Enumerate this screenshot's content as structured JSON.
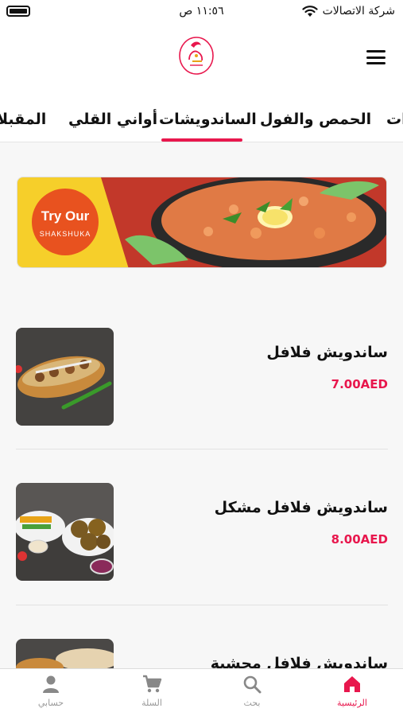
{
  "status_bar": {
    "time": "١١:٥٦ ص",
    "carrier": "شركة الاتصالات"
  },
  "header": {
    "logo_icon": "restaurant-logo-icon",
    "menu_icon": "hamburger-menu-icon"
  },
  "tabs": [
    {
      "label": "ات",
      "active": false
    },
    {
      "label": "الحمص والفول",
      "active": false
    },
    {
      "label": "الساندويشات",
      "active": true
    },
    {
      "label": "أواني القلي",
      "active": false
    },
    {
      "label": "المقبلا",
      "active": false
    }
  ],
  "banner": {
    "headline": "Try Our",
    "subline": "SHAKSHUKA"
  },
  "items": [
    {
      "name": "ساندويش  فلافل",
      "price": "7.00AED"
    },
    {
      "name": "ساندويش فلافل مشكل",
      "price": "8.00AED"
    },
    {
      "name": "ساندويش فلافل محشية",
      "price": ""
    }
  ],
  "bottom_nav": [
    {
      "label": "الرئيسية",
      "icon": "home-icon",
      "active": true
    },
    {
      "label": "بحث",
      "icon": "search-icon",
      "active": false
    },
    {
      "label": "السلة",
      "icon": "cart-icon",
      "active": false
    },
    {
      "label": "حسابي",
      "icon": "user-icon",
      "active": false
    }
  ],
  "colors": {
    "accent": "#e8174d",
    "banner_yellow": "#f6cf2a",
    "banner_red": "#c2382a"
  }
}
